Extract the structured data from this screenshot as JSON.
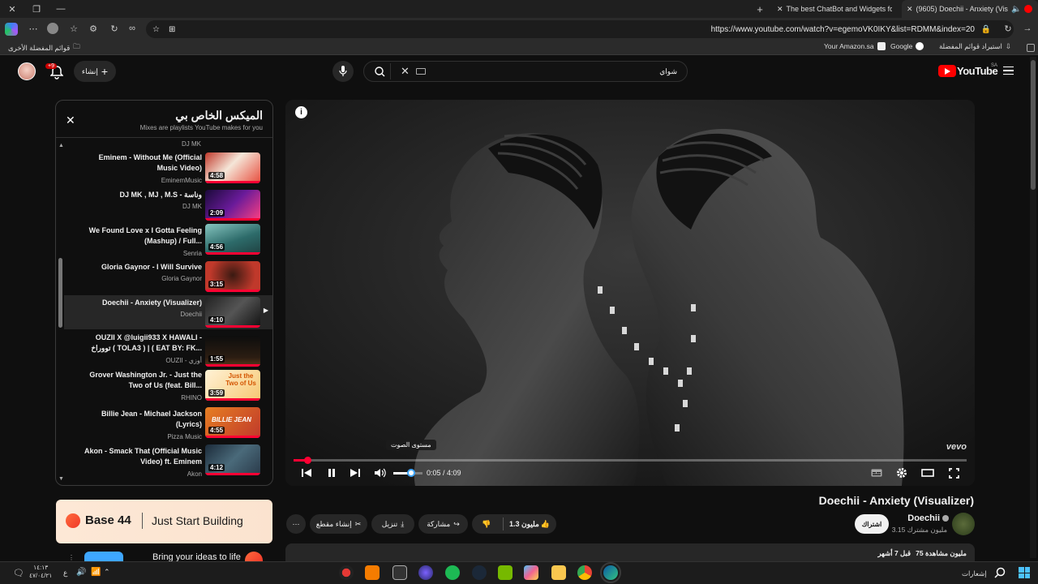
{
  "browser": {
    "tabs": [
      {
        "title": "The best ChatBot and Widgets fo",
        "active": false
      },
      {
        "title": "(9605) Doechii - Anxiety (Vis",
        "active": true
      }
    ],
    "url": "https://www.youtube.com/watch?v=egemoVK0IKY&list=RDMM&index=20",
    "favorites": {
      "other": "قوائم المفضلة الأخرى",
      "amazon": "Your Amazon.sa",
      "google": "Google",
      "import": "استيراد قوائم المفضلة"
    }
  },
  "youtube": {
    "logo": "YouTube",
    "region": "SA",
    "search_value": "شواي",
    "create_label": "إنشاء",
    "notif_count": "+9"
  },
  "playlist": {
    "title": "الميكس الخاص بي",
    "subtitle": "Mixes are playlists YouTube makes for you",
    "top_channel": "DJ MK",
    "items": [
      {
        "title": "Eminem - Without Me (Official Music Video)",
        "channel": "EminemMusic",
        "duration": "4:58"
      },
      {
        "title": "DJ MK , MJ , M.S - وناسة",
        "channel": "DJ MK",
        "duration": "2:09"
      },
      {
        "title": "We Found Love x I Gotta Feeling (Mashup) / Full...",
        "channel": "Senria",
        "duration": "4:56"
      },
      {
        "title": "Gloria Gaynor - I Will Survive",
        "channel": "Gloria Gaynor",
        "duration": "3:15"
      },
      {
        "title": "Doechii - Anxiety (Visualizer)",
        "channel": "Doechii",
        "duration": "4:10"
      },
      {
        "title": "OUZII X @luigii933 X HAWALI - تووراخ ( TOLA3 ) | ( EAT BY: FK...",
        "channel": "OUZII - أوزي",
        "duration": "1:55"
      },
      {
        "title": "Grover Washington Jr. - Just the Two of Us (feat. Bill...",
        "channel": "RHINO",
        "duration": "3:59"
      },
      {
        "title": "Billie Jean - Michael Jackson (Lyrics)",
        "channel": "Pizza Music",
        "duration": "4:55"
      },
      {
        "title": "Akon - Smack That (Official Music Video) ft. Eminem",
        "channel": "Akon",
        "duration": "4:12"
      }
    ],
    "thumb_text": {
      "two_of_us": "Just the Two of Us",
      "billie": "BILLIE JEAN"
    }
  },
  "player": {
    "time": "0:05 / 4:09",
    "tooltip": "مستوى الصوت",
    "watermark": "vevo",
    "progress": 0.02,
    "volume": 0.6
  },
  "video": {
    "title": "Doechii - Anxiety (Visualizer)",
    "channel": "Doechii",
    "subscribers": "3.15 مليون مشترك",
    "subscribe": "اشتراك",
    "likes": "1.3 مليون",
    "share": "مشاركة",
    "download": "تنزيل",
    "clip": "إنشاء مقطع",
    "views": "75 مليون مشاهدة",
    "ago": "قبل 7 أشهر"
  },
  "ad": {
    "brand": "Base 44",
    "slogan": "Just Start Building",
    "text": "Bring your ideas to life"
  },
  "taskbar": {
    "time": "١٤:١٣",
    "date": "٤٧/٠٤/٢١",
    "lang": "ع",
    "notifications": "إشعارات"
  },
  "colors": {
    "accent": "#ff0033",
    "youtube_red": "#ff0000"
  }
}
